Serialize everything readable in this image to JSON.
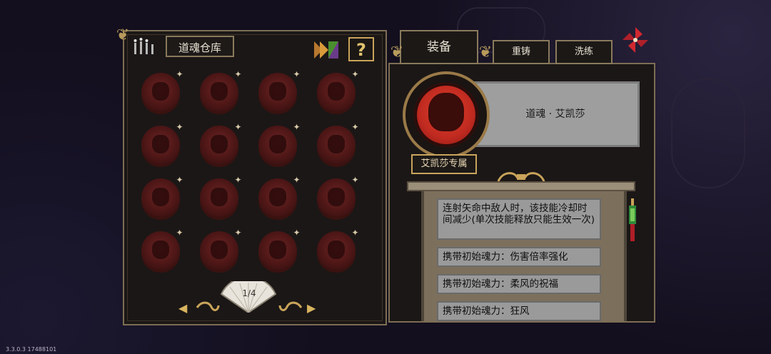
{
  "version": "3.3.0.3 17488101",
  "left_panel": {
    "title": "道魂仓库",
    "help_label": "?",
    "page_indicator": "1/4",
    "prev_arrow": "◀",
    "next_arrow": "▶",
    "souls": [
      {
        "star": "✦"
      },
      {
        "star": "✦"
      },
      {
        "star": "✦"
      },
      {
        "star": "✦"
      },
      {
        "star": "✦"
      },
      {
        "star": "✦"
      },
      {
        "star": "✦"
      },
      {
        "star": "✦"
      },
      {
        "star": "✦"
      },
      {
        "star": "✦"
      },
      {
        "star": "✦"
      },
      {
        "star": "✦"
      },
      {
        "star": "✦"
      },
      {
        "star": "✦"
      },
      {
        "star": "✦"
      },
      {
        "star": "✦"
      }
    ]
  },
  "right_panel": {
    "tabs": {
      "equip": "装备",
      "recast": "重铸",
      "refine": "洗练"
    },
    "soul_name": "道魂 · 艾凯莎",
    "exclusive_label": "艾凯莎专属",
    "effects": [
      "连射矢命中敌人时，该技能冷却时间减少(单次技能释放只能生效一次)",
      "携带初始魂力：伤害倍率强化",
      "携带初始魂力：柔风的祝福",
      "携带初始魂力：狂风"
    ]
  },
  "colors": {
    "gold": "#c9a45a",
    "soul_red": "#c02a20",
    "panel_bg": "#1b1716",
    "effect_bg": "#9a9a9a"
  }
}
